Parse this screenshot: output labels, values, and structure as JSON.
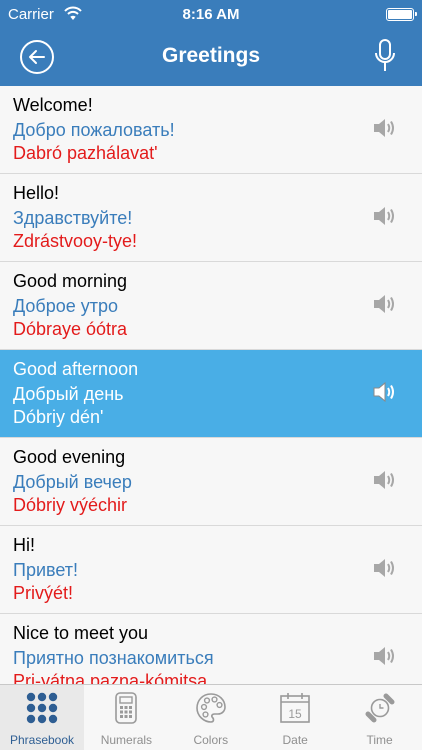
{
  "status": {
    "carrier": "Carrier",
    "time": "8:16 AM"
  },
  "nav": {
    "title": "Greetings"
  },
  "phrases": [
    {
      "en": "Welcome!",
      "ru": "Добро пожаловать!",
      "tr": "Dabró pazhálavat'"
    },
    {
      "en": "Hello!",
      "ru": "Здравствуйте!",
      "tr": "Zdrástvooy-tye!"
    },
    {
      "en": "Good morning",
      "ru": "Доброе утро",
      "tr": "Dóbraye óótra"
    },
    {
      "en": "Good afternoon",
      "ru": "Добрый день",
      "tr": "Dóbriy dén'"
    },
    {
      "en": "Good evening",
      "ru": "Добрый вечер",
      "tr": "Dóbriy výéchir"
    },
    {
      "en": "Hi!",
      "ru": "Привет!",
      "tr": "Privýét!"
    },
    {
      "en": "Nice to meet you",
      "ru": "Приятно познакомиться",
      "tr": "Pri-yátna pazna-kómitsa"
    }
  ],
  "selected_index": 3,
  "tabs": [
    {
      "label": "Phrasebook",
      "icon": "grid-dots-icon"
    },
    {
      "label": "Numerals",
      "icon": "calculator-icon"
    },
    {
      "label": "Colors",
      "icon": "palette-icon"
    },
    {
      "label": "Date",
      "icon": "calendar-icon",
      "day": "15"
    },
    {
      "label": "Time",
      "icon": "watch-icon"
    }
  ],
  "active_tab": 0,
  "colors": {
    "header": "#3a7dbb",
    "selected_row": "#49aee6",
    "russian_text": "#3a7dbb",
    "transliteration_text": "#e31b1b",
    "active_tab_label": "#2e5e93"
  }
}
